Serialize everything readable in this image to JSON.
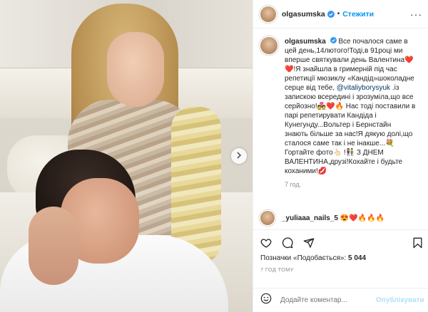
{
  "post": {
    "username": "olgasumska",
    "follow_label": "Стежити",
    "more_label": "···",
    "caption": {
      "author": "olgasumska",
      "part1": "Все почалося саме в цей день,14лютого!Тоді,в 91році ми вперше святкували день Валентина❤️ ❤️!Я знайшла в гримерній під час репетиції мюзиклу «Кандід»шоколадне серце від тебе, ",
      "mention": "@vitaliyborysyuk",
      "part2": " .із запискою всередині і зрозуміла,що все серйозно!💑❤️🔥 Нас тоді поставили в парі репетирувати Кандіда і Кунегунду...Вольтер і Бернстайн знають більше за нас!Я дякую долі,що сталося саме так і не інакше...💐 Гортайте фото👆🏻 !👫 З ДНЕМ ВАЛЕНТИНА,друзі!Кохайте і будьте коханими!💋"
    },
    "caption_time": "7 год.",
    "comment": {
      "author": "_yuliaaa_nails_5",
      "text": "😍❤️🔥🔥🔥"
    },
    "likes": {
      "label": "Позначки «Подобається»:",
      "count": "5 044"
    },
    "posted_time": "7 год тому",
    "add_comment_placeholder": "Додайте коментар...",
    "publish_label": "Опублікувати"
  },
  "colors": {
    "accent": "#0095f6",
    "mention": "#00376b",
    "muted": "#8e8e8e",
    "publish_disabled": "#b2dffc"
  },
  "icons": [
    "verified-badge-icon",
    "heart-icon",
    "comment-icon",
    "share-icon",
    "bookmark-icon",
    "emoji-icon",
    "next-arrow-icon"
  ]
}
